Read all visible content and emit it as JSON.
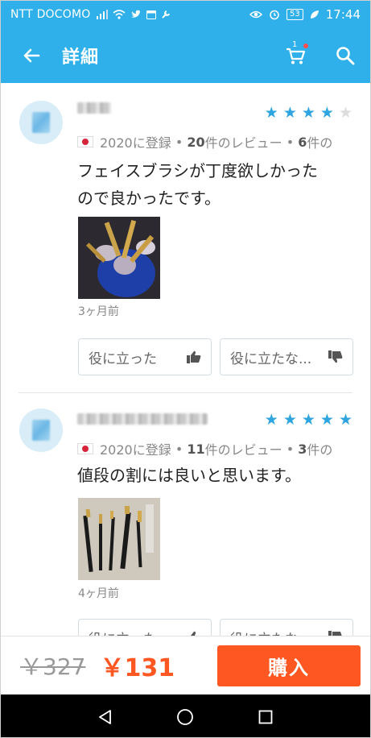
{
  "status_bar": {
    "carrier": "NTT DOCOMO",
    "battery": "53",
    "time": "17:44"
  },
  "app_bar": {
    "title": "詳細",
    "cart_count": "1"
  },
  "reviews": [
    {
      "rating": 4,
      "registered": "2020に登録",
      "review_count": "20",
      "review_label": "件のレビュー",
      "photo_count": "6",
      "photo_label": "件の",
      "text_line1": "フェイスブラシが丁度欲しかった",
      "text_line2": "ので良かったです。",
      "time_ago": "3ヶ月前",
      "helpful_label": "役に立った",
      "not_helpful_label": "役に立たな..."
    },
    {
      "rating": 5,
      "registered": "2020に登録",
      "review_count": "11",
      "review_label": "件のレビュー",
      "photo_count": "3",
      "photo_label": "件の",
      "text_line1": "値段の割には良いと思います。",
      "time_ago": "4ヶ月前",
      "helpful_label": "役に立った",
      "not_helpful_label": "役に立たな..."
    }
  ],
  "purchase": {
    "old_price": "￥327",
    "new_price": "￥131",
    "buy_label": "購入"
  },
  "colors": {
    "header": "#2fb0ea",
    "star": "#2fa5e0",
    "accent": "#ff5722"
  },
  "icons": {
    "back": "arrow-left-icon",
    "cart": "cart-icon",
    "search": "search-icon",
    "helpful": "thumbs-up-icon",
    "not_helpful": "thumbs-down-icon",
    "nav_back": "nav-back-icon",
    "nav_home": "nav-home-icon",
    "nav_recent": "nav-recent-icon"
  }
}
